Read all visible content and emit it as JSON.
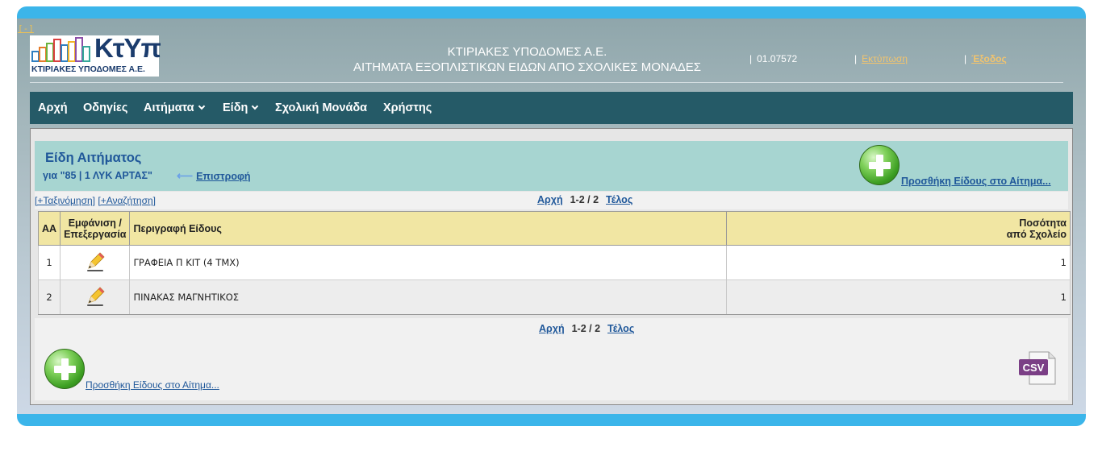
{
  "header": {
    "collapse_label": "[-]",
    "logo_brand": "ΚτΥπ",
    "logo_caption": "ΚΤΙΡΙΑΚΕΣ ΥΠΟΔΟΜΕΣ Α.Ε.",
    "title_line1": "ΚΤΙΡΙΑΚΕΣ ΥΠΟΔΟΜΕΣ Α.Ε.",
    "title_line2": "ΑΙΤΗΜΑΤΑ ΕΞΟΠΛΙΣΤΙΚΩΝ ΕΙΔΩΝ ΑΠΟ ΣΧΟΛΙΚΕΣ ΜΟΝΑΔΕΣ",
    "separator": "|",
    "user_code": "01.07572",
    "print_label": "Εκτύπωση",
    "exit_label": "Έξοδος"
  },
  "nav": {
    "home": "Αρχή",
    "instructions": "Οδηγίες",
    "requests": "Αιτήματα",
    "items": "Είδη",
    "school_unit": "Σχολική Μονάδα",
    "user": "Χρήστης"
  },
  "section": {
    "title": "Είδη Αιτήματος",
    "subtitle": "για \"85 | 1 ΛΥΚ ΑΡΤΑΣ\"",
    "back_label": "Επιστροφή",
    "add_item_top": "Προσθήκη Είδους στο Αίτημα...",
    "add_item_bottom": "Προσθήκη Είδους στο Αίτημα..."
  },
  "toolbar": {
    "sort_label": "[+Ταξινόμηση]",
    "search_label": "[+Αναζήτηση]"
  },
  "pager": {
    "first": "Αρχή",
    "count": "1-2 / 2",
    "last": "Τέλος"
  },
  "table": {
    "columns": {
      "aa": "ΑΑ",
      "edit_line1": "Εμφάνιση /",
      "edit_line2": "Επεξεργασία",
      "description": "Περιγραφή Είδους",
      "qty_line1": "Ποσότητα",
      "qty_line2": "από Σχολείο"
    },
    "rows": [
      {
        "aa": "1",
        "description": "ΓΡΑΦΕΙΑ Π ΚΙΤ (4 ΤΜΧ)",
        "qty": "1"
      },
      {
        "aa": "2",
        "description": "ΠΙΝΑΚΑΣ ΜΑΓΝΗΤΙΚΟΣ",
        "qty": "1"
      }
    ]
  },
  "export": {
    "csv_label": "CSV",
    "csv_color": "#7b3f86"
  },
  "icons": [
    "plus-circle-icon",
    "pencil-icon",
    "csv-file-icon",
    "chevron-down-icon",
    "back-arrow-icon"
  ]
}
